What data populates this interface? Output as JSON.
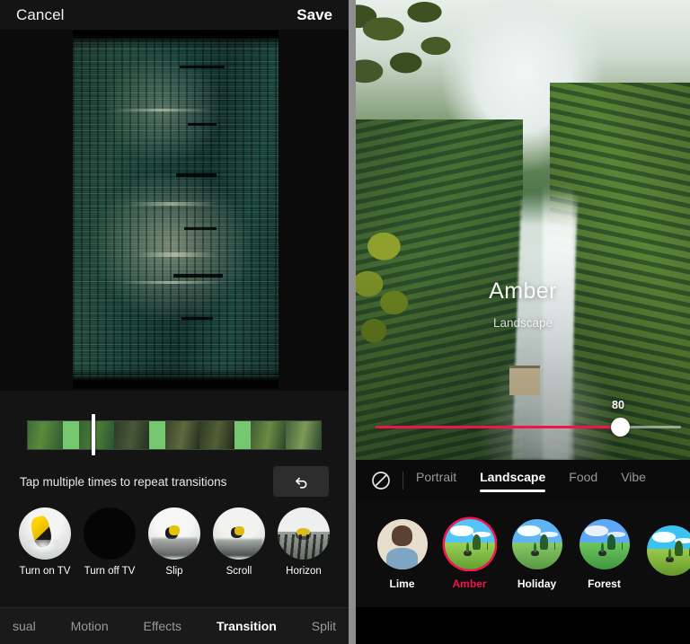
{
  "left_panel": {
    "topbar": {
      "cancel_label": "Cancel",
      "save_label": "Save"
    },
    "hint_text": "Tap multiple times to repeat transitions",
    "undo_icon": "undo-arrow-icon",
    "transitions": [
      {
        "label": "Turn on TV",
        "thumb": "skier-yellow-jacket"
      },
      {
        "label": "Turn off TV",
        "thumb": "black-screen"
      },
      {
        "label": "Slip",
        "thumb": "snow-skier-small"
      },
      {
        "label": "Scroll",
        "thumb": "snow-skier-small"
      },
      {
        "label": "Horizon",
        "thumb": "snow-horizon"
      }
    ],
    "bottom_tabs": [
      {
        "label": "sual",
        "active": false
      },
      {
        "label": "Motion",
        "active": false
      },
      {
        "label": "Effects",
        "active": false
      },
      {
        "label": "Transition",
        "active": true
      },
      {
        "label": "Split",
        "active": false
      }
    ]
  },
  "right_panel": {
    "filter_overlay": {
      "name": "Amber",
      "category": "Landscape"
    },
    "slider": {
      "value": 80,
      "min": 0,
      "max": 100,
      "fill_color": "#f0134d",
      "track_color": "#ebebeb"
    },
    "category_tabs": {
      "no_filter_icon": "circle-slash-icon",
      "items": [
        {
          "label": "Portrait",
          "active": false
        },
        {
          "label": "Landscape",
          "active": true
        },
        {
          "label": "Food",
          "active": false
        },
        {
          "label": "Vibe",
          "active": false
        }
      ]
    },
    "filters": [
      {
        "label": "Lime",
        "selected": false,
        "thumb": "portrait-man"
      },
      {
        "label": "Amber",
        "selected": true,
        "thumb": "landscape-field"
      },
      {
        "label": "Holiday",
        "selected": false,
        "thumb": "landscape-field"
      },
      {
        "label": "Forest",
        "selected": false,
        "thumb": "landscape-field"
      },
      {
        "label": "",
        "selected": false,
        "thumb": "landscape-field-partial"
      }
    ],
    "accent_color": "#f0134d"
  }
}
